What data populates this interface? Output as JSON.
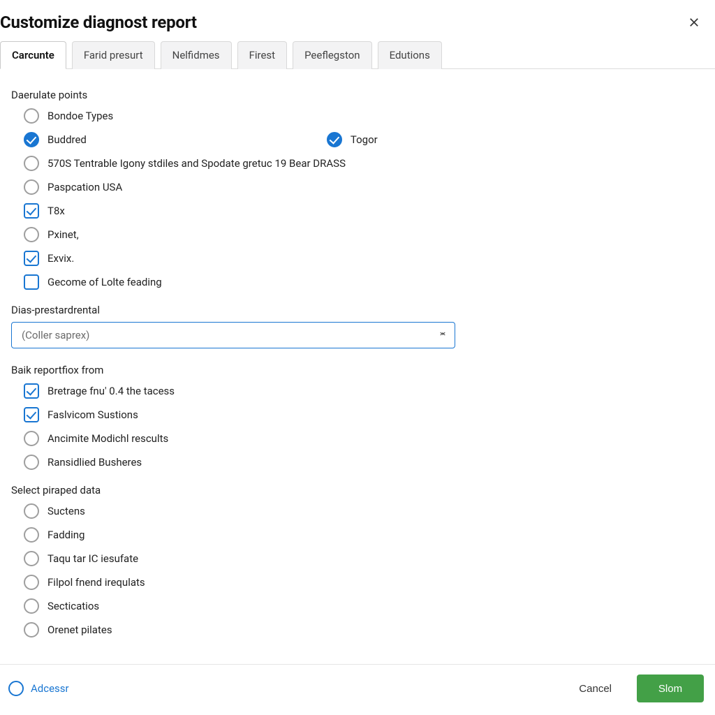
{
  "dialog": {
    "title": "Customize diagnost report"
  },
  "tabs": [
    {
      "id": "carcunte",
      "label": "Carcunte",
      "active": true
    },
    {
      "id": "farid",
      "label": "Farid presurt",
      "active": false
    },
    {
      "id": "nelfidmes",
      "label": "Nelfidmes",
      "active": false
    },
    {
      "id": "firest",
      "label": "Firest",
      "active": false
    },
    {
      "id": "peefleg",
      "label": "Peeflegston",
      "active": false
    },
    {
      "id": "edutions",
      "label": "Edutions",
      "active": false
    }
  ],
  "section1": {
    "heading": "Daerulate points",
    "items": [
      {
        "kind": "radio",
        "checked": false,
        "label": "Bondoe Types"
      },
      {
        "kind": "dual",
        "left": {
          "kind": "radio",
          "checked": true,
          "label": "Buddred",
          "style": "filled-circle"
        },
        "right": {
          "kind": "radio",
          "checked": true,
          "label": "Togor",
          "style": "filled-circle"
        }
      },
      {
        "kind": "radio",
        "checked": false,
        "label": "570S Tentrable Igony stdiles and Spodate gretuc 19 Bear DRASS"
      },
      {
        "kind": "radio",
        "checked": false,
        "label": "Paspcation USA"
      },
      {
        "kind": "check-square-outline",
        "checked": true,
        "label": "T8x"
      },
      {
        "kind": "radio",
        "checked": false,
        "label": "Pxinet,"
      },
      {
        "kind": "check-square-outline",
        "checked": true,
        "label": "Exvix."
      },
      {
        "kind": "check-square",
        "checked": false,
        "label": "Gecome of Lolte feading"
      }
    ]
  },
  "section2": {
    "heading": "Dias-prestardrental",
    "select_value": "(Coller saprex)"
  },
  "section3": {
    "heading": "Baik reportfiox from",
    "items": [
      {
        "kind": "check-square-outline",
        "checked": true,
        "label": "Bretrage fnu' 0.4 the tacess"
      },
      {
        "kind": "check-square-outline",
        "checked": true,
        "label": "Faslvicom Sustions"
      },
      {
        "kind": "radio",
        "checked": false,
        "label": "Ancimite Modichl rescults"
      },
      {
        "kind": "radio",
        "checked": false,
        "label": "Ransidlied Busheres"
      }
    ]
  },
  "section4": {
    "heading": "Select piraped data",
    "items": [
      {
        "kind": "radio",
        "checked": false,
        "label": "Suctens"
      },
      {
        "kind": "radio",
        "checked": false,
        "label": "Fadding"
      },
      {
        "kind": "radio",
        "checked": false,
        "label": "Taqu tar IС iesufate"
      },
      {
        "kind": "radio",
        "checked": false,
        "label": "Filpol fnend irequlats"
      },
      {
        "kind": "radio",
        "checked": false,
        "label": "Secticatios"
      },
      {
        "kind": "radio",
        "checked": false,
        "label": "Orenet pilates"
      }
    ]
  },
  "footer": {
    "left_link": "Adcessr",
    "cancel": "Cancel",
    "primary": "Slom"
  }
}
